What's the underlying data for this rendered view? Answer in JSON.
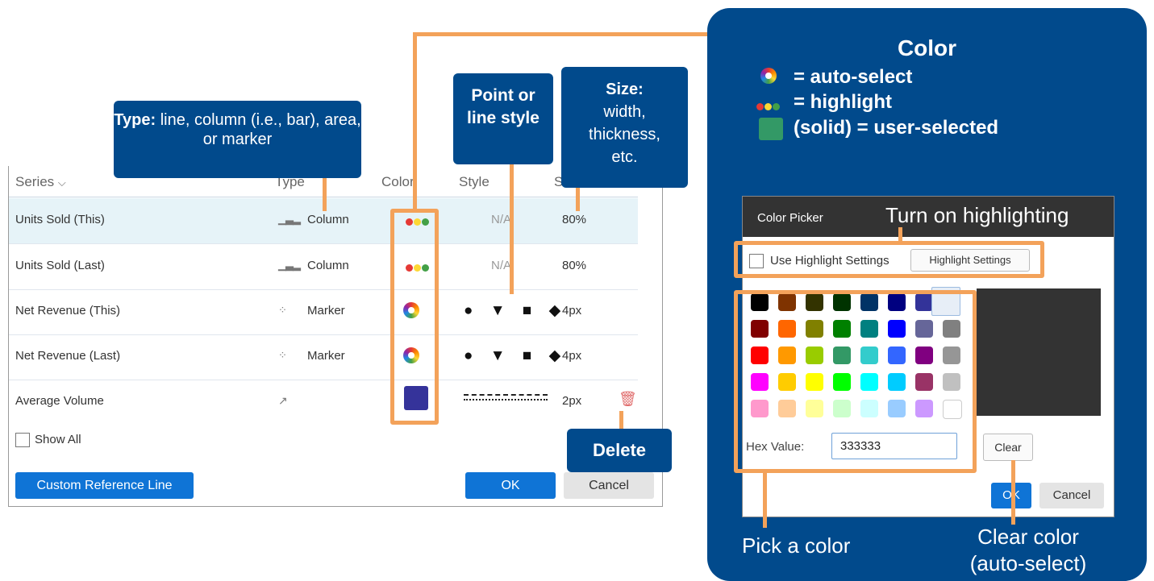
{
  "callouts": {
    "type_bold": "Type:",
    "type_text": " line, column (i.e., bar), area, or marker",
    "point_style": "Point or line style",
    "size_bold": "Size:",
    "size_text": "width, thickness, etc.",
    "delete": "Delete"
  },
  "table": {
    "headers": {
      "series": "Series",
      "type": "Type",
      "color": "Color",
      "style": "Style",
      "size": "Size"
    },
    "rows": [
      {
        "name": "Units Sold (This)",
        "type": "Column",
        "color": "highlight",
        "style": "N/A",
        "size": "80%"
      },
      {
        "name": "Units Sold (Last)",
        "type": "Column",
        "color": "highlight",
        "style": "N/A",
        "size": "80%"
      },
      {
        "name": "Net Revenue (This)",
        "type": "Marker",
        "color": "auto-select",
        "style": "● ▼ ■ ◆",
        "size": "4px"
      },
      {
        "name": "Net Revenue (Last)",
        "type": "Marker",
        "color": "auto-select",
        "style": "● ▼ ■ ◆",
        "size": "4px"
      },
      {
        "name": "Average Volume",
        "type": "",
        "color": "#35339a",
        "style": "dashed-line",
        "size": "2px"
      }
    ],
    "show_all": "Show All",
    "custom_ref": "Custom Reference Line",
    "ok": "OK",
    "cancel": "Cancel"
  },
  "color_panel": {
    "title": "Color",
    "auto": "= auto-select",
    "highlight": "= highlight",
    "user": "(solid) = user-selected",
    "turn_on": "Turn on highlighting",
    "pick": "Pick a color",
    "clear_color": "Clear color (auto-select)"
  },
  "picker": {
    "title": "Color Picker",
    "use_highlight": "Use Highlight Settings",
    "highlight_btn": "Highlight Settings",
    "hex_label": "Hex Value:",
    "hex_value": "333333",
    "clear": "Clear",
    "ok": "OK",
    "cancel": "Cancel",
    "swatches": [
      [
        "#000000",
        "#7f3300",
        "#333300",
        "#003300",
        "#003366",
        "#000080",
        "#333399",
        "#333333"
      ],
      [
        "#800000",
        "#ff6600",
        "#808000",
        "#008000",
        "#008080",
        "#0000ff",
        "#666699",
        "#808080"
      ],
      [
        "#ff0000",
        "#ff9900",
        "#99cc00",
        "#339966",
        "#33cccc",
        "#3366ff",
        "#800080",
        "#969696"
      ],
      [
        "#ff00ff",
        "#ffcc00",
        "#ffff00",
        "#00ff00",
        "#00ffff",
        "#00ccff",
        "#993366",
        "#c0c0c0"
      ],
      [
        "#ff99cc",
        "#ffcc99",
        "#ffff99",
        "#ccffcc",
        "#ccffff",
        "#99ccff",
        "#cc99ff",
        "#ffffff"
      ]
    ],
    "preview_color": "#333333"
  }
}
